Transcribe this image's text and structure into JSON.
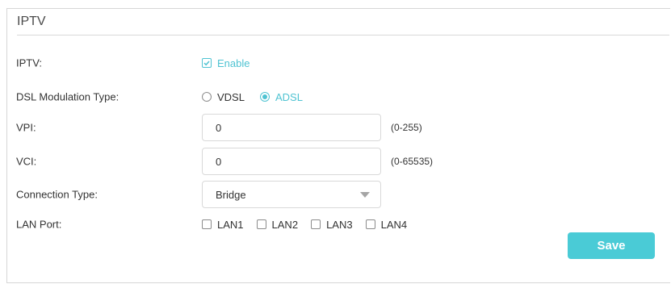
{
  "section": {
    "title": "IPTV"
  },
  "iptv": {
    "label": "IPTV:",
    "enable_label": "Enable",
    "enabled": true
  },
  "dsl": {
    "label": "DSL Modulation Type:",
    "options": [
      {
        "label": "VDSL",
        "selected": false
      },
      {
        "label": "ADSL",
        "selected": true
      }
    ]
  },
  "vpi": {
    "label": "VPI:",
    "value": "0",
    "hint": "(0-255)"
  },
  "vci": {
    "label": "VCI:",
    "value": "0",
    "hint": "(0-65535)"
  },
  "connection": {
    "label": "Connection Type:",
    "selected": "Bridge"
  },
  "lan": {
    "label": "LAN Port:",
    "ports": [
      {
        "label": "LAN1",
        "checked": false
      },
      {
        "label": "LAN2",
        "checked": false
      },
      {
        "label": "LAN3",
        "checked": false
      },
      {
        "label": "LAN4",
        "checked": false
      }
    ]
  },
  "actions": {
    "save_label": "Save"
  },
  "colors": {
    "accent": "#4fc3d2",
    "save_button": "#4acbd6",
    "border": "#d9d9d9"
  }
}
